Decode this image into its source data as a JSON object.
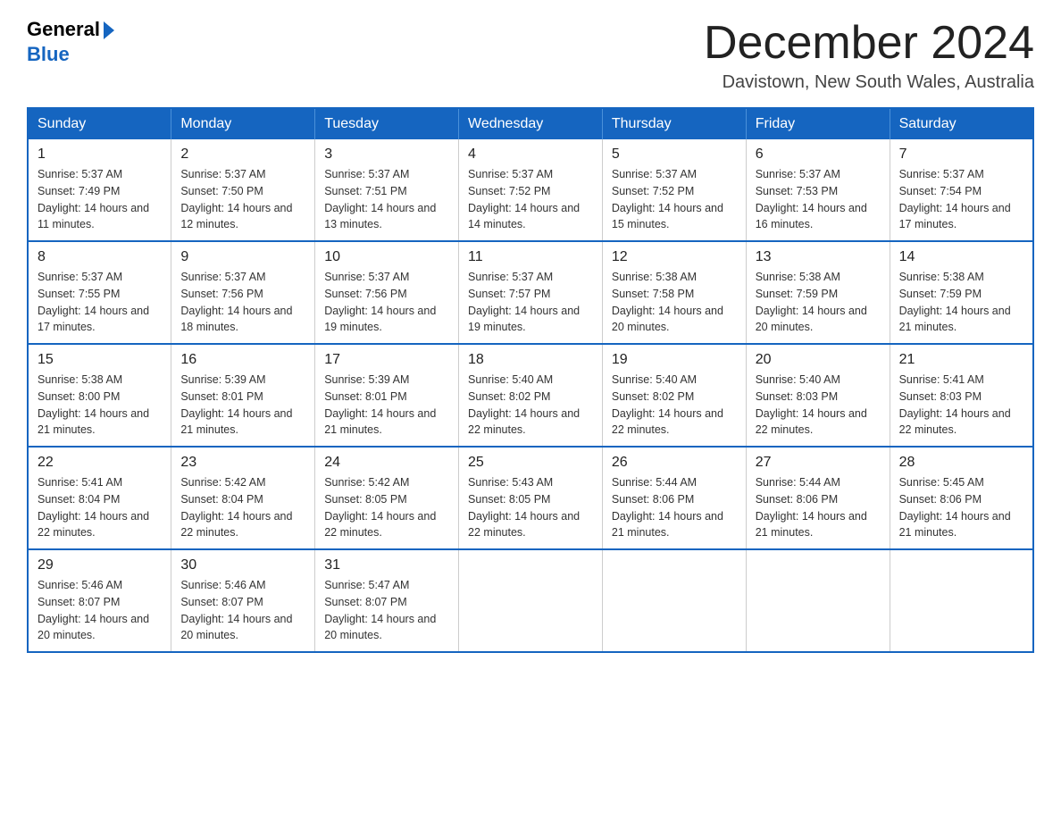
{
  "logo": {
    "general": "General",
    "blue": "Blue"
  },
  "title": "December 2024",
  "location": "Davistown, New South Wales, Australia",
  "weekdays": [
    "Sunday",
    "Monday",
    "Tuesday",
    "Wednesday",
    "Thursday",
    "Friday",
    "Saturday"
  ],
  "weeks": [
    [
      {
        "day": "1",
        "sunrise": "5:37 AM",
        "sunset": "7:49 PM",
        "daylight": "14 hours and 11 minutes."
      },
      {
        "day": "2",
        "sunrise": "5:37 AM",
        "sunset": "7:50 PM",
        "daylight": "14 hours and 12 minutes."
      },
      {
        "day": "3",
        "sunrise": "5:37 AM",
        "sunset": "7:51 PM",
        "daylight": "14 hours and 13 minutes."
      },
      {
        "day": "4",
        "sunrise": "5:37 AM",
        "sunset": "7:52 PM",
        "daylight": "14 hours and 14 minutes."
      },
      {
        "day": "5",
        "sunrise": "5:37 AM",
        "sunset": "7:52 PM",
        "daylight": "14 hours and 15 minutes."
      },
      {
        "day": "6",
        "sunrise": "5:37 AM",
        "sunset": "7:53 PM",
        "daylight": "14 hours and 16 minutes."
      },
      {
        "day": "7",
        "sunrise": "5:37 AM",
        "sunset": "7:54 PM",
        "daylight": "14 hours and 17 minutes."
      }
    ],
    [
      {
        "day": "8",
        "sunrise": "5:37 AM",
        "sunset": "7:55 PM",
        "daylight": "14 hours and 17 minutes."
      },
      {
        "day": "9",
        "sunrise": "5:37 AM",
        "sunset": "7:56 PM",
        "daylight": "14 hours and 18 minutes."
      },
      {
        "day": "10",
        "sunrise": "5:37 AM",
        "sunset": "7:56 PM",
        "daylight": "14 hours and 19 minutes."
      },
      {
        "day": "11",
        "sunrise": "5:37 AM",
        "sunset": "7:57 PM",
        "daylight": "14 hours and 19 minutes."
      },
      {
        "day": "12",
        "sunrise": "5:38 AM",
        "sunset": "7:58 PM",
        "daylight": "14 hours and 20 minutes."
      },
      {
        "day": "13",
        "sunrise": "5:38 AM",
        "sunset": "7:59 PM",
        "daylight": "14 hours and 20 minutes."
      },
      {
        "day": "14",
        "sunrise": "5:38 AM",
        "sunset": "7:59 PM",
        "daylight": "14 hours and 21 minutes."
      }
    ],
    [
      {
        "day": "15",
        "sunrise": "5:38 AM",
        "sunset": "8:00 PM",
        "daylight": "14 hours and 21 minutes."
      },
      {
        "day": "16",
        "sunrise": "5:39 AM",
        "sunset": "8:01 PM",
        "daylight": "14 hours and 21 minutes."
      },
      {
        "day": "17",
        "sunrise": "5:39 AM",
        "sunset": "8:01 PM",
        "daylight": "14 hours and 21 minutes."
      },
      {
        "day": "18",
        "sunrise": "5:40 AM",
        "sunset": "8:02 PM",
        "daylight": "14 hours and 22 minutes."
      },
      {
        "day": "19",
        "sunrise": "5:40 AM",
        "sunset": "8:02 PM",
        "daylight": "14 hours and 22 minutes."
      },
      {
        "day": "20",
        "sunrise": "5:40 AM",
        "sunset": "8:03 PM",
        "daylight": "14 hours and 22 minutes."
      },
      {
        "day": "21",
        "sunrise": "5:41 AM",
        "sunset": "8:03 PM",
        "daylight": "14 hours and 22 minutes."
      }
    ],
    [
      {
        "day": "22",
        "sunrise": "5:41 AM",
        "sunset": "8:04 PM",
        "daylight": "14 hours and 22 minutes."
      },
      {
        "day": "23",
        "sunrise": "5:42 AM",
        "sunset": "8:04 PM",
        "daylight": "14 hours and 22 minutes."
      },
      {
        "day": "24",
        "sunrise": "5:42 AM",
        "sunset": "8:05 PM",
        "daylight": "14 hours and 22 minutes."
      },
      {
        "day": "25",
        "sunrise": "5:43 AM",
        "sunset": "8:05 PM",
        "daylight": "14 hours and 22 minutes."
      },
      {
        "day": "26",
        "sunrise": "5:44 AM",
        "sunset": "8:06 PM",
        "daylight": "14 hours and 21 minutes."
      },
      {
        "day": "27",
        "sunrise": "5:44 AM",
        "sunset": "8:06 PM",
        "daylight": "14 hours and 21 minutes."
      },
      {
        "day": "28",
        "sunrise": "5:45 AM",
        "sunset": "8:06 PM",
        "daylight": "14 hours and 21 minutes."
      }
    ],
    [
      {
        "day": "29",
        "sunrise": "5:46 AM",
        "sunset": "8:07 PM",
        "daylight": "14 hours and 20 minutes."
      },
      {
        "day": "30",
        "sunrise": "5:46 AM",
        "sunset": "8:07 PM",
        "daylight": "14 hours and 20 minutes."
      },
      {
        "day": "31",
        "sunrise": "5:47 AM",
        "sunset": "8:07 PM",
        "daylight": "14 hours and 20 minutes."
      },
      null,
      null,
      null,
      null
    ]
  ]
}
